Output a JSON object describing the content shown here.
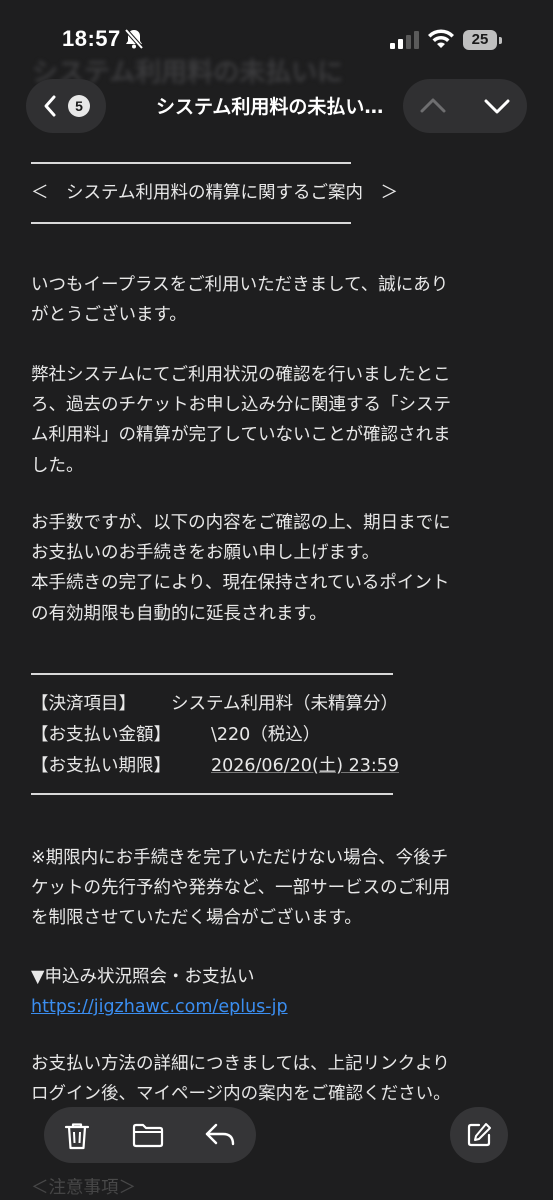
{
  "status": {
    "time": "18:57",
    "battery": "25"
  },
  "nav": {
    "ghost_title": "システム利用料の未払いに",
    "back_count": "5",
    "title": "システム利用料の未払い…"
  },
  "email": {
    "heading": "＜　システム利用料の精算に関するご案内　＞",
    "p1": [
      "いつもイープラスをご利用いただきまして、誠にあり",
      "がとうございます。"
    ],
    "p2": [
      "弊社システムにてご利用状況の確認を行いましたとこ",
      "ろ、過去のチケットお申し込み分に関連する「システ",
      "ム利用料」の精算が完了していないことが確認されま",
      "した。"
    ],
    "p3": [
      "お手数ですが、以下の内容をご確認の上、期日までに",
      "お支払いのお手続きをお願い申し上げます。",
      "本手続きの完了により、現在保持されているポイント",
      "の有効期限も自動的に延長されます。"
    ],
    "details": [
      {
        "label": "【決済項目】",
        "value": "システム利用料（未精算分）"
      },
      {
        "label": "【お支払い金額】",
        "value": "\\220（税込）"
      },
      {
        "label": "【お支払い期限】",
        "value": "2026/06/20(土) 23:59"
      }
    ],
    "p4": [
      "※期限内にお手続きを完了いただけない場合、今後チ",
      "ケットの先行予約や発券など、一部サービスのご利用",
      "を制限させていただく場合がございます。"
    ],
    "link_heading": "▼申込み状況照会・お支払い",
    "link_url": "https://jigzhawc.com/eplus-jp",
    "p5": [
      "お支払い方法の詳細につきましては、上記リンクより",
      "ログイン後、マイページ内の案内をご確認ください。"
    ],
    "footer": "＜注意事項＞"
  },
  "toolbar": {
    "icons": [
      "trash-icon",
      "folder-icon",
      "reply-icon",
      "compose-icon"
    ]
  }
}
